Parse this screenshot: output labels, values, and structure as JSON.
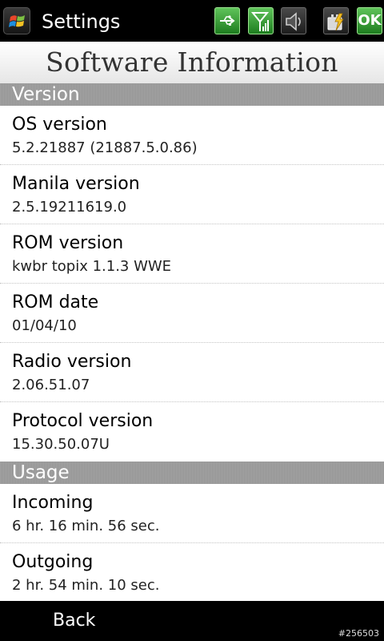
{
  "status_bar": {
    "app_title": "Settings",
    "ok_label": "OK",
    "icons": [
      "windows-start-icon",
      "usb-icon",
      "signal-icon",
      "speaker-icon",
      "battery-charging-icon"
    ]
  },
  "header": {
    "title": "Software Information"
  },
  "sections": [
    {
      "title": "Version",
      "rows": [
        {
          "label": "OS version",
          "value": "5.2.21887 (21887.5.0.86)"
        },
        {
          "label": "Manila version",
          "value": "2.5.19211619.0"
        },
        {
          "label": "ROM version",
          "value": "kwbr topix 1.1.3 WWE"
        },
        {
          "label": "ROM date",
          "value": "01/04/10"
        },
        {
          "label": "Radio version",
          "value": "2.06.51.07"
        },
        {
          "label": "Protocol version",
          "value": "15.30.50.07U"
        }
      ]
    },
    {
      "title": "Usage",
      "rows": [
        {
          "label": "Incoming",
          "value": "6 hr. 16 min. 56 sec."
        },
        {
          "label": "Outgoing",
          "value": "2 hr. 54 min. 10 sec."
        }
      ]
    }
  ],
  "softkeys": {
    "left": "Back"
  },
  "watermark": "#256503",
  "colors": {
    "accent_green": "#2e9a2c",
    "section_header": "#9b9b9b"
  }
}
